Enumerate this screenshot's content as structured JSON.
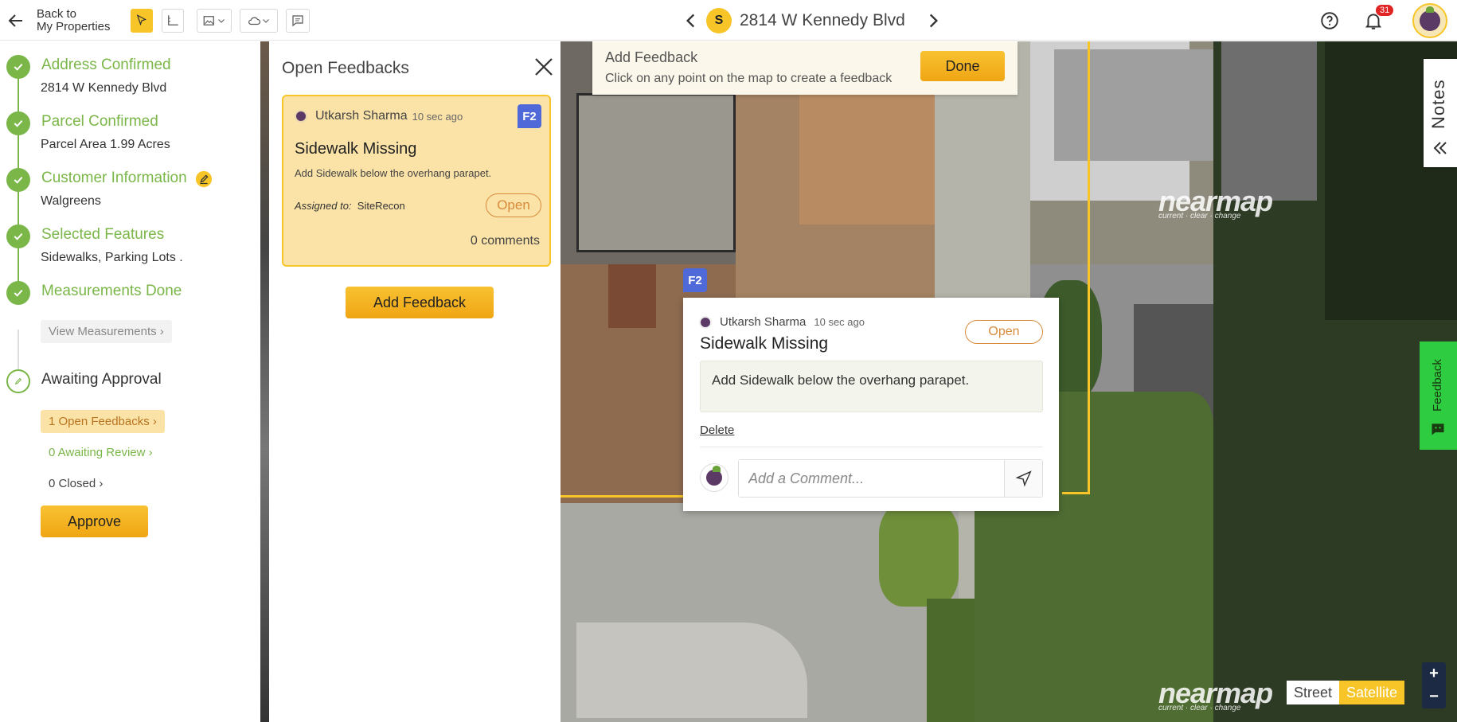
{
  "header": {
    "back_line1": "Back to",
    "back_line2": "My Properties",
    "address": "2814 W Kennedy Blvd",
    "site_badge": "S",
    "notification_count": "31"
  },
  "steps": [
    {
      "title": "Address Confirmed",
      "sub": "2814 W Kennedy Blvd"
    },
    {
      "title": "Parcel Confirmed",
      "sub": "Parcel Area 1.99 Acres"
    },
    {
      "title": "Customer Information",
      "sub": "Walgreens"
    },
    {
      "title": "Selected Features",
      "sub": "Sidewalks, Parking Lots ."
    },
    {
      "title": "Measurements Done",
      "sub": ""
    }
  ],
  "view_measurements": "View Measurements",
  "awaiting": {
    "title": "Awaiting Approval",
    "open_feedbacks": "1 Open Feedbacks",
    "awaiting_review": "0 Awaiting Review",
    "closed": "0 Closed",
    "approve": "Approve"
  },
  "panel": {
    "title": "Open Feedbacks",
    "card": {
      "user": "Utkarsh Sharma",
      "time": "10 sec ago",
      "tag": "F2",
      "title": "Sidewalk Missing",
      "desc": "Add Sidewalk below the overhang parapet.",
      "assigned_label": "Assigned to:",
      "assigned_to": "SiteRecon",
      "status": "Open",
      "comments": "0 comments"
    },
    "add_button": "Add Feedback"
  },
  "add_bar": {
    "title": "Add Feedback",
    "hint": "Click on any point on the map to create a feedback",
    "done": "Done"
  },
  "popup": {
    "user": "Utkarsh Sharma",
    "time": "10 sec ago",
    "status": "Open",
    "title": "Sidewalk Missing",
    "desc": "Add Sidewalk below the overhang parapet.",
    "delete": "Delete",
    "comment_placeholder": "Add a Comment..."
  },
  "map": {
    "marker": "F2",
    "notes_tab": "Notes",
    "feedback_tab": "Feedback",
    "watermark": "nearmap",
    "watermark_sub": "current · clear · change",
    "street": "Street",
    "satellite": "Satellite",
    "zoom_in": "+",
    "zoom_out": "−"
  },
  "colors": {
    "accent": "#f7c528",
    "success": "#7ab648",
    "open_status": "#d88a3b",
    "marker": "#4f6ad8"
  }
}
